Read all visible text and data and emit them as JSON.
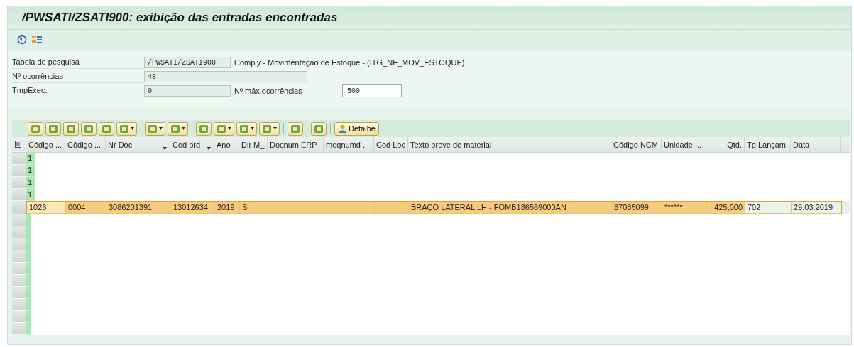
{
  "window": {
    "title": "/PWSATI/ZSATI900: exibição das entradas encontradas"
  },
  "form": [
    {
      "label": "Tabela de pesquisa",
      "value": "/PWSATI/ZSATI900",
      "kind": "readonly_short",
      "description": "Comply - Movimentação de Estoque - (ITG_NF_MOV_ESTOQUE)"
    },
    {
      "label": "Nº ocorrências",
      "value": "48",
      "kind": "readonly_long"
    },
    {
      "label": "TmpExec.",
      "value": "0",
      "kind": "readonly_short",
      "extra_label": "Nº máx.ocorrências",
      "extra_value": "500"
    }
  ],
  "alv_toolbar": {
    "detail_button": "Detalhe"
  },
  "table": {
    "columns": [
      {
        "label": "Código ...",
        "sort": false
      },
      {
        "label": "Código ...",
        "sort": false
      },
      {
        "label": "Nr Doc",
        "sort": true
      },
      {
        "label": "Cod prd",
        "sort": true
      },
      {
        "label": "Ano",
        "sort": false
      },
      {
        "label": "Dir M_",
        "sort": false
      },
      {
        "label": "Docnum ERP",
        "sort": false
      },
      {
        "label": "meqnumd ...",
        "sort": false
      },
      {
        "label": "Cod Loc",
        "sort": false
      },
      {
        "label": "Texto breve de material",
        "sort": false
      },
      {
        "label": "Código NCM",
        "sort": false
      },
      {
        "label": "Unidade ...",
        "sort": false
      },
      {
        "label": "Qtd.",
        "sort": false
      },
      {
        "label": "Tp Lançam",
        "sort": false
      },
      {
        "label": "Data",
        "sort": false
      }
    ],
    "rows": [
      {
        "selected": false,
        "cells": [
          "1"
        ]
      },
      {
        "selected": false,
        "cells": [
          "1"
        ]
      },
      {
        "selected": false,
        "cells": [
          "1"
        ]
      },
      {
        "selected": false,
        "cells": [
          "1"
        ]
      },
      {
        "selected": true,
        "cells": [
          "1026",
          "0004",
          "3086201391",
          "13012634",
          "2019",
          "S",
          null,
          null,
          null,
          "BRAÇO LATERAL LH - FOMB186569000AN",
          "87085099",
          "******",
          "425,000",
          "702",
          "29.03.2019"
        ]
      }
    ]
  }
}
